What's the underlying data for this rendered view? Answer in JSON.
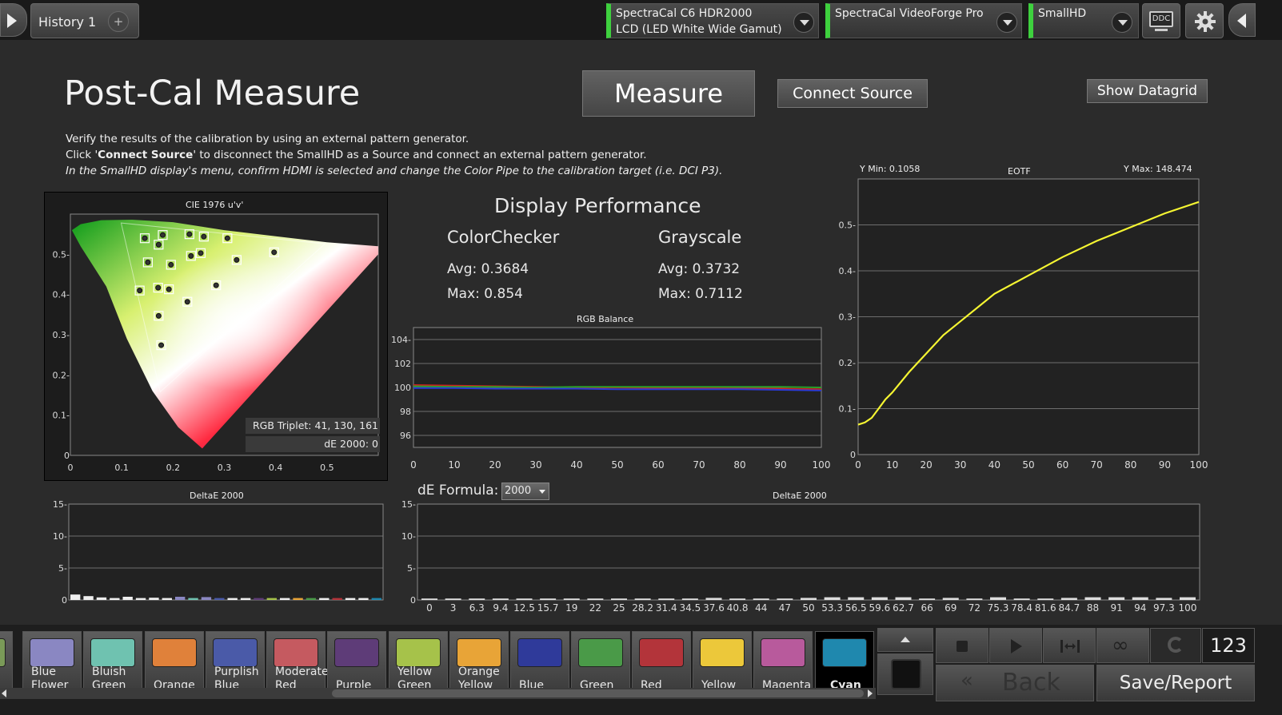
{
  "tabs": [
    {
      "label": "History 1"
    }
  ],
  "add_tab": "+",
  "devices": [
    {
      "line1": "SpectraCal C6 HDR2000",
      "line2": "LCD (LED White Wide Gamut)"
    },
    {
      "line1": "SpectraCal VideoForge Pro",
      "line2": ""
    },
    {
      "line1": "SmallHD",
      "line2": ""
    }
  ],
  "ddc_label": "DDC",
  "page_title": "Post-Cal Measure",
  "buttons": {
    "measure": "Measure",
    "connect_source": "Connect Source",
    "show_datagrid": "Show Datagrid"
  },
  "instructions": {
    "line1": "Verify the results of the calibration by using an external pattern generator.",
    "line2_pre": "Click '",
    "line2_bold": "Connect Source",
    "line2_post": "' to disconnect the SmallHD as a Source and connect an external pattern generator.",
    "line3": "In the SmallHD display's menu, confirm HDMI is selected and change the Color Pipe to the calibration target (i.e. DCI P3)."
  },
  "cie": {
    "title": "CIE 1976 u'v'",
    "rgb_triplet": "RGB Triplet: 41, 130, 161",
    "de_2000": "dE 2000: 0"
  },
  "performance": {
    "title": "Display Performance",
    "colorchecker": {
      "heading": "ColorChecker",
      "avg": "Avg: 0.3684",
      "max": "Max: 0.854"
    },
    "grayscale": {
      "heading": "Grayscale",
      "avg": "Avg: 0.3732",
      "max": "Max: 0.7112"
    }
  },
  "eotf": {
    "ymin": "Y Min: 0.1058",
    "title": "EOTF",
    "ymax": "Y Max: 148.474"
  },
  "de_formula": {
    "label": "dE Formula:",
    "value": "2000"
  },
  "bottom_buttons": {
    "back": "Back",
    "save_report": "Save/Report",
    "counter": "123"
  },
  "swatches": [
    {
      "line1": "",
      "line2": "ge",
      "color": "#7a9a58"
    },
    {
      "line1": "Blue",
      "line2": "Flower",
      "color": "#8a87c2"
    },
    {
      "line1": "Bluish",
      "line2": "Green",
      "color": "#6fc2b0"
    },
    {
      "line1": "",
      "line2": "Orange",
      "color": "#e0813a"
    },
    {
      "line1": "Purplish",
      "line2": "Blue",
      "color": "#4a5aa8"
    },
    {
      "line1": "Moderate",
      "line2": "Red",
      "color": "#c55a60"
    },
    {
      "line1": "",
      "line2": "Purple",
      "color": "#5e3c78"
    },
    {
      "line1": "Yellow",
      "line2": "Green",
      "color": "#a6c24a"
    },
    {
      "line1": "Orange",
      "line2": "Yellow",
      "color": "#e8a437"
    },
    {
      "line1": "",
      "line2": "Blue",
      "color": "#2f3a9a"
    },
    {
      "line1": "",
      "line2": "Green",
      "color": "#4a9a48"
    },
    {
      "line1": "",
      "line2": "Red",
      "color": "#b3343a"
    },
    {
      "line1": "",
      "line2": "Yellow",
      "color": "#ecc83a"
    },
    {
      "line1": "",
      "line2": "Magenta",
      "color": "#b85a9c"
    },
    {
      "line1": "",
      "line2": "Cyan",
      "color": "#1f88ae"
    }
  ],
  "selected_swatch": "Cyan",
  "chart_data": [
    {
      "type": "scatter",
      "title": "CIE 1976 u'v'",
      "xlim": [
        0,
        0.6
      ],
      "ylim": [
        0,
        0.6
      ],
      "xticks": [
        "0",
        "0.1",
        "0.2",
        "0.3",
        "0.4",
        "0.5"
      ],
      "yticks": [
        "0",
        "0.1-",
        "0.2-",
        "0.3-",
        "0.4-",
        "0.5-"
      ],
      "gamut_triangle": [
        [
          0.496,
          0.526
        ],
        [
          0.099,
          0.578
        ],
        [
          0.175,
          0.158
        ]
      ],
      "points": [
        {
          "u": 0.145,
          "v": 0.54
        },
        {
          "u": 0.18,
          "v": 0.548
        },
        {
          "u": 0.172,
          "v": 0.524
        },
        {
          "u": 0.232,
          "v": 0.55
        },
        {
          "u": 0.26,
          "v": 0.544
        },
        {
          "u": 0.306,
          "v": 0.54
        },
        {
          "u": 0.151,
          "v": 0.48
        },
        {
          "u": 0.196,
          "v": 0.474
        },
        {
          "u": 0.235,
          "v": 0.496
        },
        {
          "u": 0.254,
          "v": 0.503
        },
        {
          "u": 0.324,
          "v": 0.486
        },
        {
          "u": 0.397,
          "v": 0.505
        },
        {
          "u": 0.135,
          "v": 0.41
        },
        {
          "u": 0.171,
          "v": 0.417
        },
        {
          "u": 0.192,
          "v": 0.413
        },
        {
          "u": 0.284,
          "v": 0.423
        },
        {
          "u": 0.228,
          "v": 0.382
        },
        {
          "u": 0.172,
          "v": 0.347
        },
        {
          "u": 0.177,
          "v": 0.274
        }
      ]
    },
    {
      "type": "line",
      "title": "RGB Balance",
      "xlim": [
        0,
        100
      ],
      "ylim": [
        95,
        105
      ],
      "xticks": [
        "0",
        "10",
        "20",
        "30",
        "40",
        "50",
        "60",
        "70",
        "80",
        "90",
        "100"
      ],
      "yticks": [
        "96",
        "98",
        "100",
        "102",
        "104-"
      ],
      "series": [
        {
          "color": "#d02020",
          "values": [
            100.2,
            100.15,
            100.1,
            100.05,
            100.0,
            100.0,
            99.95,
            99.95,
            99.9,
            99.9,
            99.85
          ]
        },
        {
          "color": "#2aa02a",
          "values": [
            100.1,
            100.05,
            100.05,
            100.0,
            100.05,
            100.05,
            100.05,
            100.05,
            100.05,
            100.05,
            100.0
          ]
        },
        {
          "color": "#2a3ad8",
          "values": [
            99.95,
            99.95,
            99.9,
            99.9,
            99.9,
            99.85,
            99.85,
            99.85,
            99.85,
            99.8,
            99.75
          ]
        }
      ],
      "x": [
        0,
        10,
        20,
        30,
        40,
        50,
        60,
        70,
        80,
        90,
        100
      ]
    },
    {
      "type": "line",
      "title": "EOTF",
      "xlim": [
        0,
        100
      ],
      "ylim": [
        0,
        0.6
      ],
      "xticks": [
        "0",
        "10",
        "20",
        "30",
        "40",
        "50",
        "60",
        "70",
        "80",
        "90",
        "100"
      ],
      "yticks": [
        "0",
        "0.1-",
        "0.2-",
        "0.3-",
        "0.4-",
        "0.5-"
      ],
      "x": [
        0,
        2,
        4,
        6,
        8,
        10,
        15,
        20,
        25,
        30,
        40,
        50,
        60,
        70,
        80,
        90,
        100
      ],
      "y": [
        0.065,
        0.07,
        0.08,
        0.1,
        0.12,
        0.135,
        0.18,
        0.22,
        0.26,
        0.29,
        0.35,
        0.39,
        0.43,
        0.465,
        0.495,
        0.525,
        0.55
      ],
      "color": "#f5f532"
    },
    {
      "type": "bar",
      "title": "DeltaE 2000",
      "ylim": [
        0,
        15
      ],
      "yticks": [
        "0",
        "5-",
        "10-",
        "15-"
      ],
      "values": [
        0.85,
        0.6,
        0.4,
        0.3,
        0.5,
        0.3,
        0.35,
        0.3,
        0.5,
        0.3,
        0.45,
        0.3,
        0.3,
        0.3,
        0.3,
        0.3,
        0.3,
        0.3,
        0.3,
        0.3,
        0.3,
        0.3,
        0.3,
        0.3
      ],
      "colors": [
        "#eee",
        "#eee",
        "#eee",
        "#eee",
        "#eee",
        "#eee",
        "#eee",
        "#eee",
        "#8a87c2",
        "#6fc2b0",
        "#8a87c2",
        "#4a5aa8",
        "#eee",
        "#eee",
        "#5e3c78",
        "#a6c24a",
        "#eee",
        "#e8a437",
        "#4a9a48",
        "#eee",
        "#b3343a",
        "#eee",
        "#eee",
        "#1f88ae"
      ]
    },
    {
      "type": "bar",
      "title": "DeltaE 2000",
      "ylim": [
        0,
        15
      ],
      "yticks": [
        "0",
        "5-",
        "10-",
        "15-"
      ],
      "categories": [
        "0",
        "3",
        "6.3",
        "9.4",
        "12.5",
        "15.7",
        "19",
        "22",
        "25",
        "28.2",
        "31.4",
        "34.5",
        "37.6",
        "40.8",
        "44",
        "47",
        "50",
        "53.3",
        "56.5",
        "59.6",
        "62.7",
        "66",
        "69",
        "72",
        "75.3",
        "78.4",
        "81.6",
        "84.7",
        "88",
        "91",
        "94",
        "97.3",
        "100"
      ],
      "values": [
        0.1,
        0.1,
        0.1,
        0.1,
        0.1,
        0.1,
        0.1,
        0.1,
        0.1,
        0.1,
        0.1,
        0.1,
        0.2,
        0.1,
        0.1,
        0.1,
        0.2,
        0.3,
        0.3,
        0.3,
        0.3,
        0.1,
        0.2,
        0.1,
        0.3,
        0.1,
        0.1,
        0.2,
        0.3,
        0.3,
        0.3,
        0.2,
        0.3
      ]
    }
  ]
}
